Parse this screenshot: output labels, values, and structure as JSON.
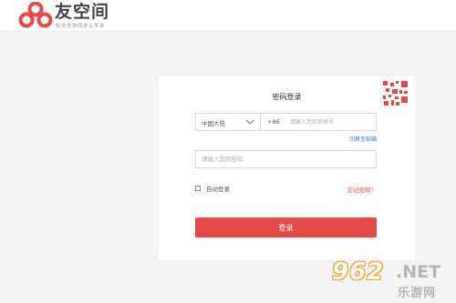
{
  "header": {
    "logo_name": "友空间",
    "logo_slogan": "社交化协同办公平台"
  },
  "login": {
    "title": "密码登录",
    "country": "中国大陆",
    "country_code": "+86",
    "phone_placeholder": "请输入您的手机号",
    "switch_email": "切换至邮箱",
    "password_placeholder": "请输入您的密码",
    "auto_login": "自动登录",
    "auto_login_checked": false,
    "forgot_password": "忘记密码？",
    "submit": "登录"
  },
  "watermark": {
    "logo": "962",
    "suffix": ".NET",
    "site": "乐游网"
  },
  "colors": {
    "brand": "#e64a4a",
    "link": "#2a7de1"
  }
}
